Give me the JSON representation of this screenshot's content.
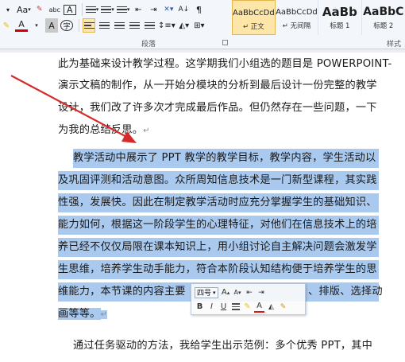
{
  "ribbon": {
    "row1": {
      "font_size_down": "A",
      "text_effects": "Aa",
      "change_case_label": "abc",
      "char_border": "A"
    },
    "row2": {
      "font_color": "A",
      "char_shading": "A",
      "enclosed_char": "字"
    },
    "paragraph_group_label": "段落",
    "styles_group_label": "样式",
    "styles": [
      {
        "preview": "AaBbCcDd",
        "name": "↵ 正文"
      },
      {
        "preview": "AaBbCcDd",
        "name": "↵ 无间隔"
      },
      {
        "preview": "AaBb",
        "name": "标题 1"
      },
      {
        "preview": "AaBbC",
        "name": "标题 2"
      }
    ]
  },
  "document": {
    "lines": [
      "此为基础来设计教学过程。这学期我们小组选的题目是 POWERPOINT-",
      "演示文稿的制作，从一开始分模块的分析到最后设计一份完整的教学",
      "设计，我们改了许多次才完成最后作品。但仍然存在一些问题，一下",
      "为我的总结反思。",
      "教学活动中展示了 PPT 教学的教学目标，教学内容，学生活动以",
      "及巩固评测和活动意图。众所周知信息技术是一门新型课程，其实践",
      "性强，发展快。因此在制定教学活动时应充分掌握学生的基础知识、",
      "能力如何，根据这一阶段学生的心理特征，对他们在信息技术上的培",
      "养已经不仅仅局限在课本知识上，用小组讨论自主解决问题会激发学",
      "生思维，培养学生动手能力，符合本阶段认知结构便于培养学生的思",
      "维能力，本节课的内容主要",
      "、排版、选择动",
      "画等等。",
      "通过任务驱动的方法，我给学生出示范例：多个优秀 PPT，其中"
    ],
    "paragraph_mark": "↵"
  },
  "mini_toolbar": {
    "font_size": "四号",
    "grow_font": "A",
    "shrink_font": "A",
    "bold": "B",
    "italic": "I",
    "underline": "U",
    "font_color": "A"
  }
}
